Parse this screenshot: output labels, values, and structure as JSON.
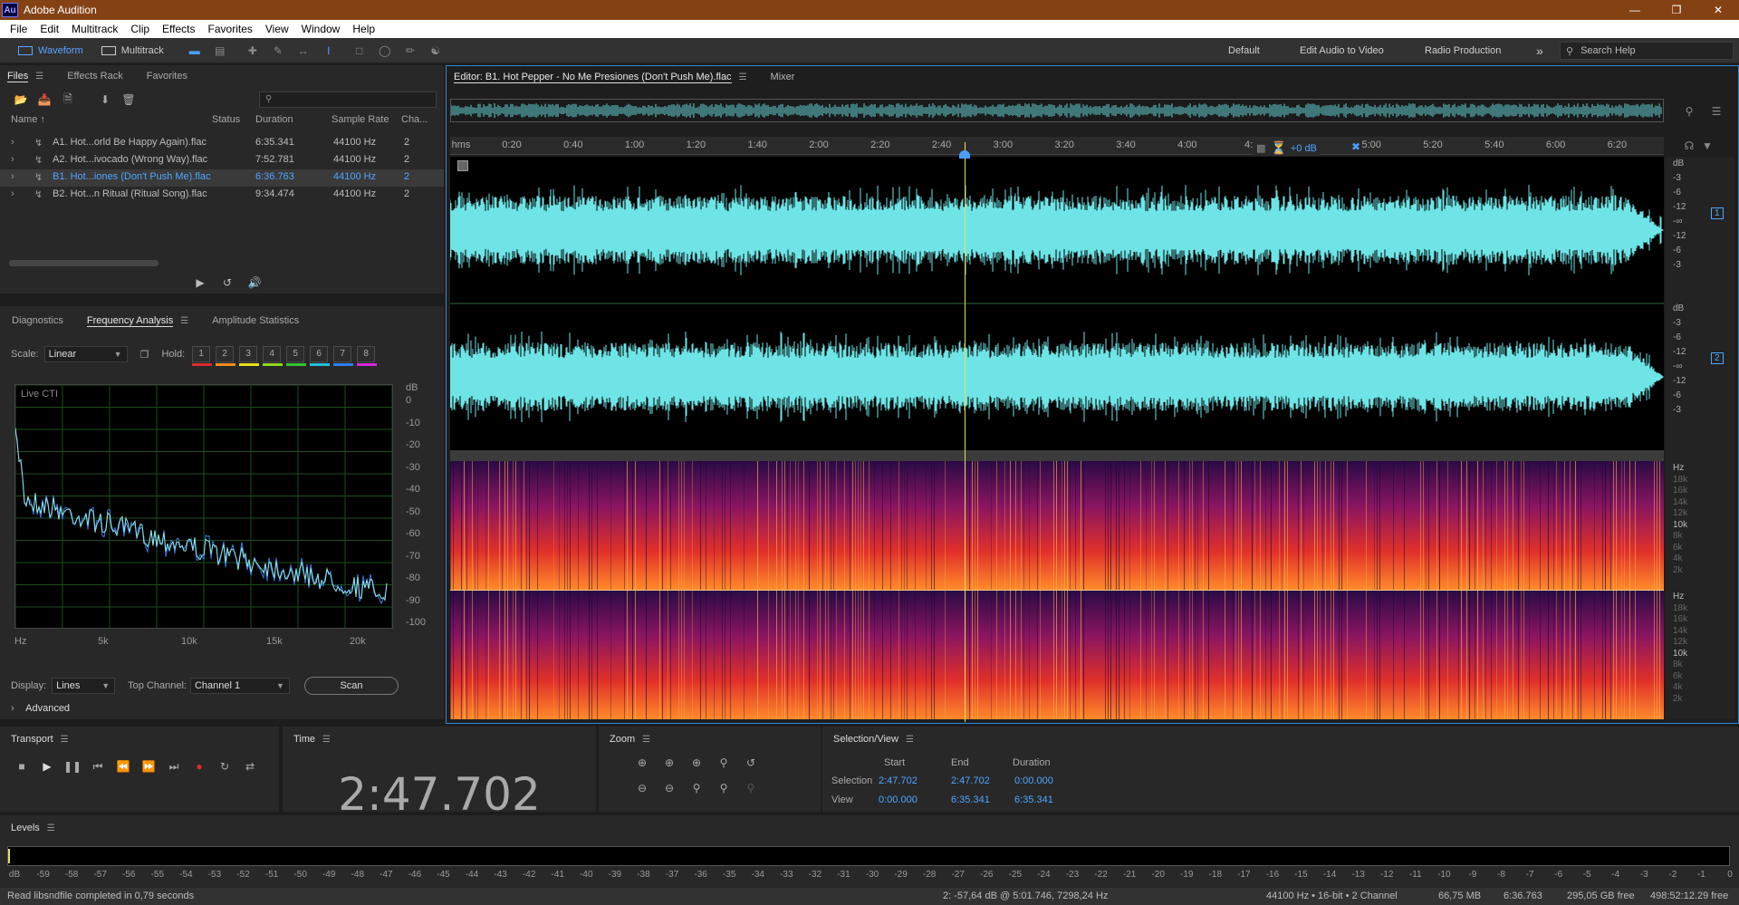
{
  "window": {
    "app_icon": "Au",
    "title": "Adobe Audition"
  },
  "menu": [
    "File",
    "Edit",
    "Multitrack",
    "Clip",
    "Effects",
    "Favorites",
    "View",
    "Window",
    "Help"
  ],
  "toolbar": {
    "waveform_label": "Waveform",
    "multitrack_label": "Multitrack",
    "workspaces": [
      "Default",
      "Edit Audio to Video",
      "Radio Production"
    ],
    "more": "»",
    "search_placeholder": "Search Help"
  },
  "files_panel": {
    "tabs": [
      "Files",
      "Effects Rack",
      "Favorites"
    ],
    "search_placeholder": "",
    "columns": [
      "Name",
      "Status",
      "Duration",
      "Sample Rate",
      "Cha..."
    ],
    "rows": [
      {
        "name": "A1. Hot...orld Be Happy Again).flac",
        "duration": "6:35.341",
        "rate": "44100 Hz",
        "ch": "2",
        "selected": false
      },
      {
        "name": "A2. Hot...ivocado (Wrong Way).flac",
        "duration": "7:52.781",
        "rate": "44100 Hz",
        "ch": "2",
        "selected": false
      },
      {
        "name": "B1. Hot...iones (Don't Push Me).flac",
        "duration": "6:36.763",
        "rate": "44100 Hz",
        "ch": "2",
        "selected": true
      },
      {
        "name": "B2. Hot...n Ritual (Ritual Song).flac",
        "duration": "9:34.474",
        "rate": "44100 Hz",
        "ch": "2",
        "selected": false
      }
    ]
  },
  "analysis_panel": {
    "tabs": [
      "Diagnostics",
      "Frequency Analysis",
      "Amplitude Statistics"
    ],
    "scale_label": "Scale:",
    "scale_value": "Linear",
    "hold_label": "Hold:",
    "hold_buttons": [
      {
        "label": "1",
        "color": "#e02a2a"
      },
      {
        "label": "2",
        "color": "#f08a1c"
      },
      {
        "label": "3",
        "color": "#e8e21a"
      },
      {
        "label": "4",
        "color": "#8fd61e"
      },
      {
        "label": "5",
        "color": "#2fc62f"
      },
      {
        "label": "6",
        "color": "#1fc0d8"
      },
      {
        "label": "7",
        "color": "#2e7df0"
      },
      {
        "label": "8",
        "color": "#d22ad8"
      }
    ],
    "graph_title": "Live CTI",
    "db_unit": "dB",
    "db_ticks": [
      "0",
      "-10",
      "-20",
      "-30",
      "-40",
      "-50",
      "-60",
      "-70",
      "-80",
      "-90",
      "-100"
    ],
    "freq_ticks": [
      "Hz",
      "5k",
      "10k",
      "15k",
      "20k"
    ],
    "display_label": "Display:",
    "display_value": "Lines",
    "top_channel_label": "Top Channel:",
    "top_channel_value": "Channel 1",
    "scan_label": "Scan",
    "advanced_label": "Advanced"
  },
  "editor": {
    "tab_label": "Editor: B1. Hot Pepper - No Me Presiones (Don't Push Me).flac",
    "mixer_label": "Mixer",
    "ruler_unit": "hms",
    "ruler_ticks": [
      "0:20",
      "0:40",
      "1:00",
      "1:20",
      "1:40",
      "2:00",
      "2:20",
      "2:40",
      "3:00",
      "3:20",
      "3:40",
      "4:00",
      "4:",
      "5:00",
      "5:20",
      "5:40",
      "6:00",
      "6:20"
    ],
    "volume_readout": "+0 dB",
    "wave_scale_top": [
      "dB",
      "-3",
      "-6",
      "-12",
      "-∞",
      "-12",
      "-6",
      "-3"
    ],
    "wave_scale_bottom": [
      "dB",
      "-3",
      "-6",
      "-12",
      "-∞",
      "-12",
      "-6",
      "-3"
    ],
    "channel_badges": [
      "1",
      "2"
    ],
    "spec_scale": [
      "Hz",
      "18k",
      "16k",
      "14k",
      "12k",
      "10k",
      "8k",
      "6k",
      "4k",
      "2k"
    ]
  },
  "transport": {
    "title": "Transport"
  },
  "time_panel": {
    "title": "Time",
    "value": "2:47.702"
  },
  "zoom_panel": {
    "title": "Zoom"
  },
  "selection_view": {
    "title": "Selection/View",
    "col_start": "Start",
    "col_end": "End",
    "col_duration": "Duration",
    "row_selection": "Selection",
    "row_view": "View",
    "sel_start": "2:47.702",
    "sel_end": "2:47.702",
    "sel_duration": "0:00.000",
    "view_start": "0:00.000",
    "view_end": "6:35.341",
    "view_duration": "6:35.341"
  },
  "levels": {
    "title": "Levels",
    "scale": [
      "dB",
      "-59",
      "-58",
      "-57",
      "-56",
      "-55",
      "-54",
      "-53",
      "-52",
      "-51",
      "-50",
      "-49",
      "-48",
      "-47",
      "-46",
      "-45",
      "-44",
      "-43",
      "-42",
      "-41",
      "-40",
      "-39",
      "-38",
      "-37",
      "-36",
      "-35",
      "-34",
      "-33",
      "-32",
      "-31",
      "-30",
      "-29",
      "-28",
      "-27",
      "-26",
      "-25",
      "-24",
      "-23",
      "-22",
      "-21",
      "-20",
      "-19",
      "-18",
      "-17",
      "-16",
      "-15",
      "-14",
      "-13",
      "-12",
      "-11",
      "-10",
      "-9",
      "-8",
      "-7",
      "-6",
      "-5",
      "-4",
      "-3",
      "-2",
      "-1",
      "0"
    ]
  },
  "status": {
    "message": "Read libsndfile completed in 0,79 seconds",
    "cursor_info": "2: -57,64 dB @ 5:01.746, 7298,24 Hz",
    "format": "44100 Hz • 16-bit • 2 Channel",
    "file_size": "66,75 MB",
    "file_duration": "6:36.763",
    "disk_free": "295,05 GB free",
    "time_free": "498:52:12.29 free"
  },
  "colors": {
    "accent": "#4fa5ff",
    "waveform": "#6ee4e6",
    "titlebar": "#844214",
    "playhead": "#e3e35a"
  }
}
